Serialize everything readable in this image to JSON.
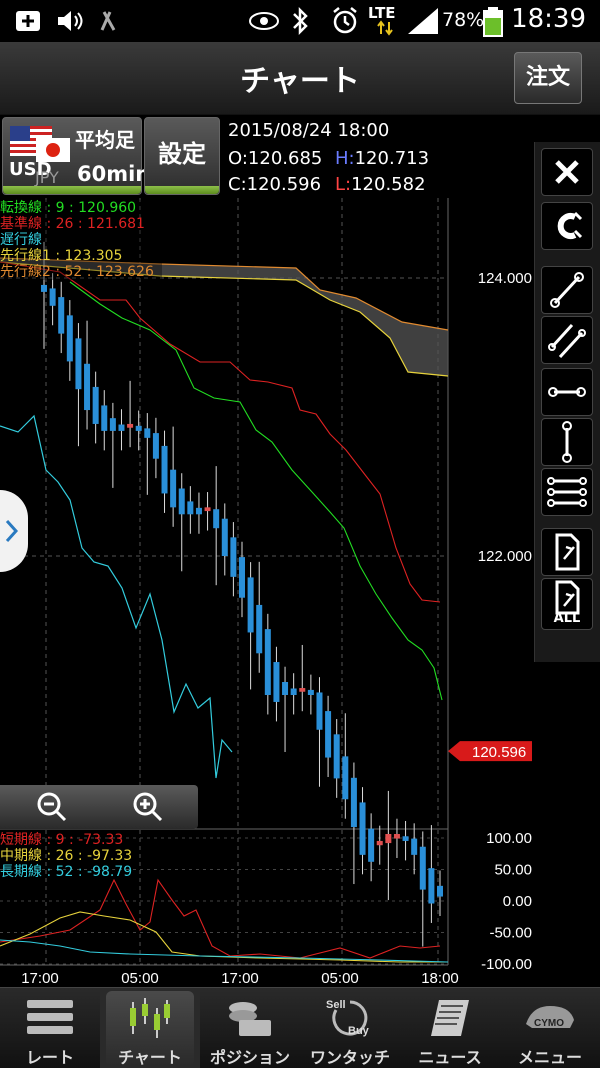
{
  "status_bar": {
    "battery": "78%",
    "time": "18:39",
    "network": "LTE"
  },
  "header": {
    "title": "チャート",
    "order_button": "注文"
  },
  "pair": {
    "base": "USD",
    "quote": "JPY",
    "candle_type": "平均足",
    "timeframe": "60min",
    "settings": "設定"
  },
  "ohlc": {
    "datetime": "2015/08/24  18:00",
    "open_label": "O:",
    "open": "120.685",
    "high_label": "H:",
    "high": "120.713",
    "close_label": "C:",
    "close": "120.596",
    "low_label": "L:",
    "low": "120.582"
  },
  "main_legend": [
    {
      "text": "転換線  : 9   : 120.960",
      "color": "#22dd22"
    },
    {
      "text": "基準線  : 26 : 121.681",
      "color": "#dd2222"
    },
    {
      "text": "遅行線",
      "color": "#33ccdd"
    },
    {
      "text": "先行線1        : 123.305",
      "color": "#e6d23c"
    },
    {
      "text": "先行線2 : 52 : 123.626",
      "color": "#e08a30"
    }
  ],
  "price_axis": [
    "124.000",
    "122.000"
  ],
  "current_price": "120.596",
  "sub_legend": [
    {
      "text": "短期線 : 9    : -73.33",
      "color": "#dd2222"
    },
    {
      "text": "中期線 : 26 : -97.33",
      "color": "#e6d23c"
    },
    {
      "text": "長期線 : 52 : -98.79",
      "color": "#33ccdd"
    }
  ],
  "sub_axis": [
    "100.00",
    "50.00",
    "0.00",
    "-50.00",
    "-100.00"
  ],
  "time_axis": [
    "17:00",
    "05:00",
    "17:00",
    "05:00",
    "18:00"
  ],
  "toolbar_icons": [
    "close-icon",
    "magnet-icon",
    "trend-line-icon",
    "parallel-line-icon",
    "horizontal-line-icon",
    "vertical-line-icon",
    "fibonacci-lines-icon",
    "delete-drawing-icon",
    "delete-all-drawings-icon"
  ],
  "toolbar_all_label": "ALL",
  "nav": [
    {
      "label": "レート",
      "icon": "rate-list-icon"
    },
    {
      "label": "チャート",
      "icon": "chart-icon",
      "active": true
    },
    {
      "label": "ポジション",
      "icon": "position-icon"
    },
    {
      "label": "ワンタッチ",
      "icon": "one-touch-icon"
    },
    {
      "label": "ニュース",
      "icon": "news-icon"
    },
    {
      "label": "メニュー",
      "icon": "menu-icon"
    }
  ],
  "nav_icon_text": {
    "sell": "Sell",
    "buy": "Buy",
    "menu": "CYMO"
  },
  "colors": {
    "conversion": "#22dd22",
    "base": "#dd2222",
    "lagging": "#33ccdd",
    "span1": "#e6d23c",
    "span2": "#e08a30",
    "candle": "#2a8fd8",
    "accent": "#6aa52a"
  },
  "chart_data": {
    "type": "line",
    "price_ylim": [
      120.0,
      125.0
    ],
    "candles_approx": [
      123.9,
      123.8,
      123.6,
      123.4,
      123.2,
      123.05,
      122.95,
      122.9,
      122.9,
      122.9,
      122.95,
      122.9,
      122.85,
      122.7,
      122.45,
      122.35,
      122.3,
      122.3,
      122.3,
      122.35,
      122.2,
      122.0,
      121.85,
      121.7,
      121.45,
      121.3,
      121.0,
      120.95,
      121.0,
      121.0,
      121.05,
      121.0,
      120.75,
      120.55,
      120.4,
      120.25,
      120.05,
      119.85,
      119.8,
      119.95,
      120.0,
      120.0,
      119.95,
      119.85,
      119.6,
      119.5,
      119.55
    ]
  }
}
